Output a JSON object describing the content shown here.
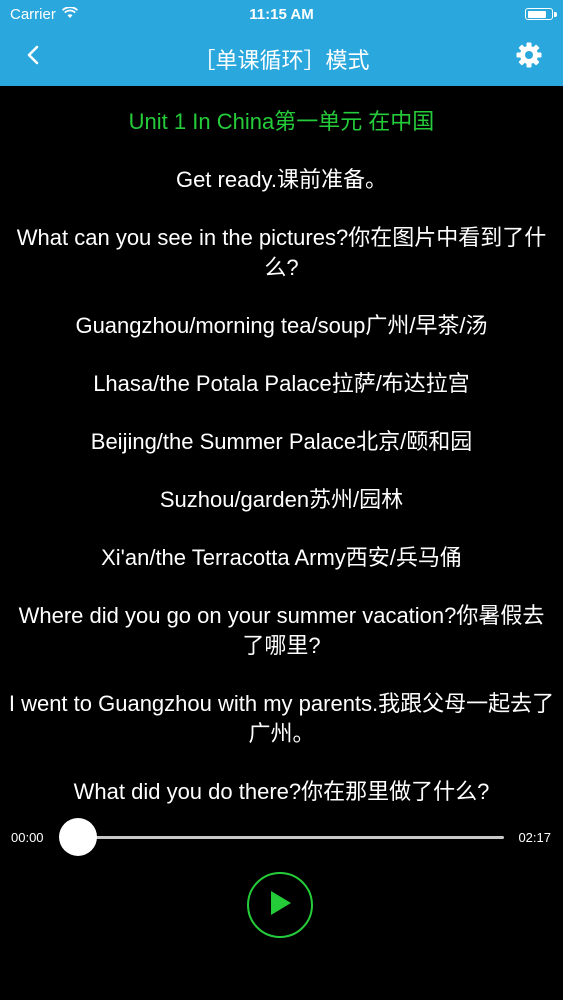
{
  "status_bar": {
    "carrier": "Carrier",
    "time": "11:15 AM",
    "battery_level": 0.85
  },
  "nav": {
    "title": "［单课循环］模式",
    "back_icon": "chevron-left-icon",
    "settings_icon": "gear-icon"
  },
  "lesson": {
    "title": "Unit 1 In China第一单元 在中国",
    "lines": [
      "Get ready.课前准备。",
      "What can you see in the pictures?你在图片中看到了什么?",
      "Guangzhou/morning tea/soup广州/早茶/汤",
      "Lhasa/the Potala Palace拉萨/布达拉宫",
      "Beijing/the Summer Palace北京/颐和园",
      "Suzhou/garden苏州/园林",
      "Xi'an/the Terracotta Army西安/兵马俑",
      "Where did you go on your summer vacation?你暑假去了哪里?",
      "I went to Guangzhou with my parents.我跟父母一起去了广州。",
      "What did you do there?你在那里做了什么?"
    ]
  },
  "player": {
    "current_time": "00:00",
    "total_time": "02:17",
    "progress": 0.04,
    "play_icon": "play-icon"
  },
  "colors": {
    "accent": "#2aa7dc",
    "title_green": "#25cc3a",
    "background": "#000000"
  }
}
